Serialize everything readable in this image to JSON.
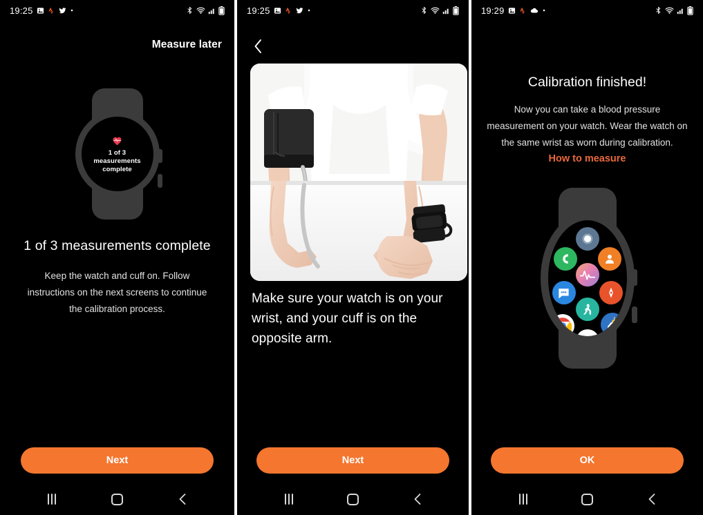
{
  "meta": {
    "accent_orange": "#f4762f",
    "link_orange": "#e8693c",
    "screen_bg": "#000000",
    "watch_body": "#3b3b3b"
  },
  "panels": [
    {
      "id": "panel-1",
      "statusbar": {
        "time": "19:25",
        "left_icons": [
          "gallery-icon",
          "strava-icon",
          "twitter-icon",
          "more-dot-icon"
        ],
        "right_icons": [
          "bluetooth-icon",
          "wifi-icon",
          "signal-icon",
          "battery-icon"
        ]
      },
      "header": {
        "measure_later": "Measure later"
      },
      "watch_face": {
        "icon": "heart-icon",
        "line1": "1 of 3",
        "line2": "measurements",
        "line3": "complete"
      },
      "title": "1 of 3 measurements complete",
      "body": "Keep the watch and cuff on. Follow instructions on the next screens to continue the calibration process.",
      "primary_button": "Next",
      "navbar": {
        "recents": "recents-button",
        "home": "home-button",
        "back": "back-button"
      }
    },
    {
      "id": "panel-2",
      "statusbar": {
        "time": "19:25",
        "left_icons": [
          "gallery-icon",
          "strava-icon",
          "twitter-icon",
          "more-dot-icon"
        ],
        "right_icons": [
          "bluetooth-icon",
          "wifi-icon",
          "signal-icon",
          "battery-icon"
        ]
      },
      "header": {
        "back": "back-chevron-icon"
      },
      "photo_alt": "Person seated at a white table wearing a white t-shirt, a black blood pressure cuff on the left upper arm with grey tube, and a black smartwatch on the right wrist",
      "caption": "Make sure your watch is on your wrist, and your cuff is on the opposite arm.",
      "primary_button": "Next",
      "navbar": {
        "recents": "recents-button",
        "home": "home-button",
        "back": "back-button"
      }
    },
    {
      "id": "panel-3",
      "statusbar": {
        "time": "19:29",
        "left_icons": [
          "gallery-icon",
          "strava-icon",
          "cloud-icon",
          "more-dot-icon"
        ],
        "right_icons": [
          "bluetooth-icon",
          "wifi-icon",
          "signal-icon",
          "battery-icon"
        ]
      },
      "title": "Calibration finished!",
      "body": "Now you can take a blood pressure measurement on your watch. Wear the watch on the same wrist as worn during calibration.",
      "link": "How to measure",
      "watch_apps": [
        {
          "name": "samsung-wear-app-icon",
          "bg": "#5d7793",
          "glyph": "circle"
        },
        {
          "name": "phone-app-icon",
          "bg": "#2eb760",
          "glyph": "phone"
        },
        {
          "name": "contacts-app-icon",
          "bg": "#f07f25",
          "glyph": "person"
        },
        {
          "name": "samsung-health-app-icon",
          "bg": "#e98ca8",
          "glyph": "heartrate"
        },
        {
          "name": "messages-app-icon",
          "bg": "#2a87e0",
          "glyph": "chat"
        },
        {
          "name": "compass-app-icon",
          "bg": "#e8532b",
          "glyph": "compass"
        },
        {
          "name": "fitness-app-icon",
          "bg": "#28b5a0",
          "glyph": "runner"
        },
        {
          "name": "chrome-app-icon",
          "bg": "#ffffff",
          "glyph": "chrome"
        },
        {
          "name": "play-store-app-icon",
          "bg": "#ffffff",
          "glyph": "play"
        },
        {
          "name": "weather-app-icon",
          "bg": "#2f73c4",
          "glyph": "weather"
        }
      ],
      "primary_button": "OK",
      "navbar": {
        "recents": "recents-button",
        "home": "home-button",
        "back": "back-button"
      }
    }
  ]
}
